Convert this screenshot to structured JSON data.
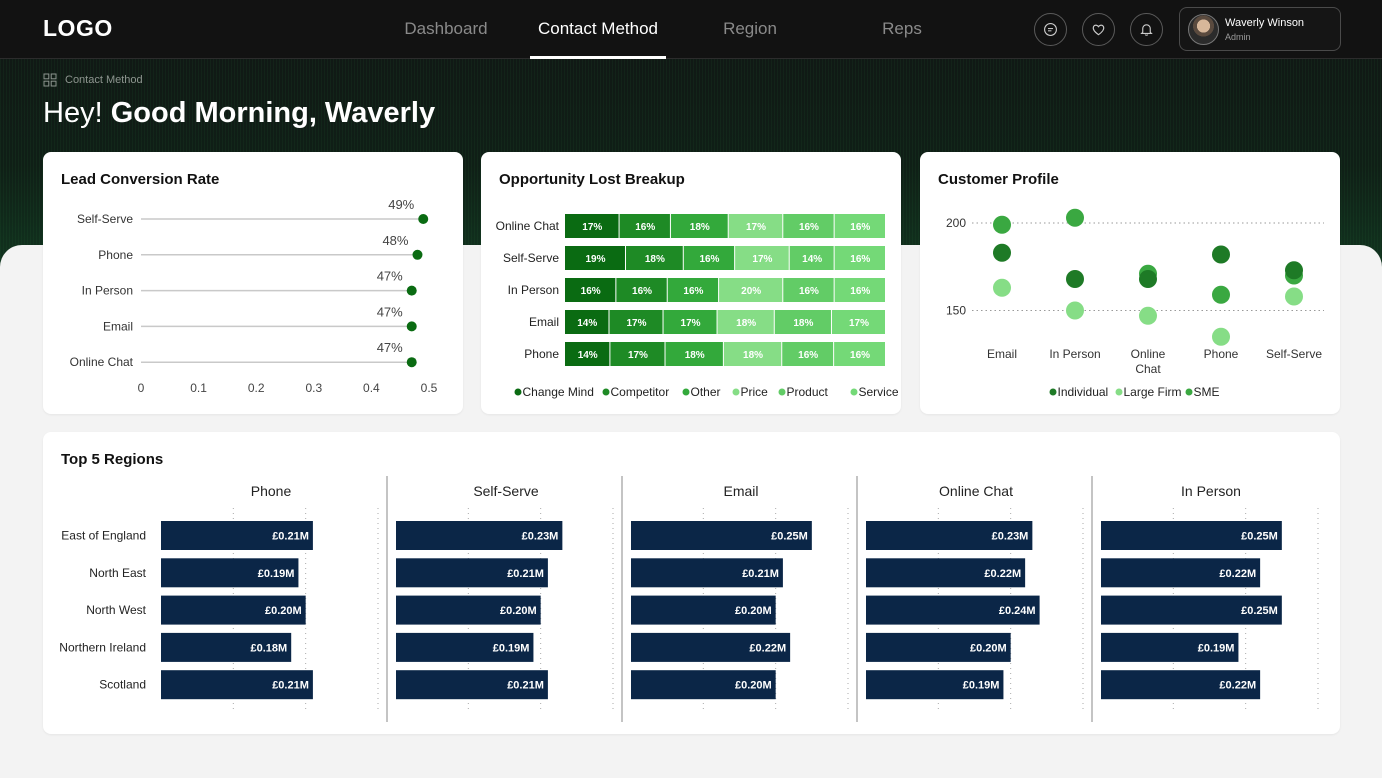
{
  "header": {
    "logo": "LOGO",
    "nav": [
      {
        "label": "Dashboard",
        "active": false
      },
      {
        "label": "Contact Method",
        "active": true
      },
      {
        "label": "Region",
        "active": false
      },
      {
        "label": "Reps",
        "active": false
      }
    ],
    "icons": [
      "chat-icon",
      "heart-icon",
      "bell-icon"
    ],
    "user": {
      "name": "Waverly Winson",
      "role": "Admin"
    }
  },
  "breadcrumb": "Contact Method",
  "greeting": {
    "prefix": "Hey!",
    "main": "Good Morning, Waverly"
  },
  "colors": {
    "dark_green": "#0a6b12",
    "green_1": "#1e8a25",
    "green_2": "#33a93b",
    "light_green": "#86dd86",
    "mid_green": "#62cc66",
    "pale_green": "#74d977",
    "navy": "#0b2647"
  },
  "chart_data": [
    {
      "id": "lead",
      "type": "lollipop",
      "title": "Lead Conversion Rate",
      "categories": [
        "Self-Serve",
        "Phone",
        "In Person",
        "Email",
        "Online Chat"
      ],
      "values": [
        0.49,
        0.48,
        0.47,
        0.47,
        0.47
      ],
      "labels": [
        "49%",
        "48%",
        "47%",
        "47%",
        "47%"
      ],
      "xlim": [
        0,
        0.5
      ],
      "xticks": [
        "0",
        "0.1",
        "0.2",
        "0.3",
        "0.4",
        "0.5"
      ]
    },
    {
      "id": "opportunity",
      "type": "stacked-bar",
      "title": "Opportunity Lost Breakup",
      "categories": [
        "Online Chat",
        "Self-Serve",
        "In Person",
        "Email",
        "Phone"
      ],
      "series": [
        {
          "name": "Change Mind",
          "color": "#0a6b12",
          "values": [
            17,
            19,
            16,
            14,
            14
          ],
          "labels": [
            "17%",
            "19%",
            "16%",
            "14%",
            "14%"
          ]
        },
        {
          "name": "Competitor",
          "color": "#1e8a25",
          "values": [
            16,
            18,
            16,
            17,
            17
          ],
          "labels": [
            "16%",
            "18%",
            "16%",
            "17%",
            "17%"
          ]
        },
        {
          "name": "Other",
          "color": "#33a93b",
          "values": [
            18,
            16,
            16,
            17,
            18
          ],
          "labels": [
            "18%",
            "16%",
            "16%",
            "17%",
            "18%"
          ]
        },
        {
          "name": "Price",
          "color": "#86dd86",
          "values": [
            17,
            17,
            20,
            18,
            18
          ],
          "labels": [
            "17%",
            "17%",
            "20%",
            "18%",
            "18%"
          ]
        },
        {
          "name": "Product",
          "color": "#62cc66",
          "values": [
            16,
            14,
            16,
            18,
            16
          ],
          "labels": [
            "16%",
            "14%",
            "16%",
            "18%",
            "16%"
          ]
        },
        {
          "name": "Service",
          "color": "#74d977",
          "values": [
            16,
            16,
            16,
            17,
            16
          ],
          "labels": [
            "16%",
            "16%",
            "16%",
            "17%",
            "16%"
          ]
        }
      ]
    },
    {
      "id": "profile",
      "type": "scatter",
      "title": "Customer Profile",
      "categories": [
        "Email",
        "In Person",
        "Online Chat",
        "Phone",
        "Self-Serve"
      ],
      "series": [
        {
          "name": "Individual",
          "color": "#1e7a26",
          "values": [
            183,
            168,
            168,
            182,
            173
          ]
        },
        {
          "name": "Large Firm",
          "color": "#86dd86",
          "values": [
            163,
            150,
            147,
            135,
            158
          ]
        },
        {
          "name": "SME",
          "color": "#3aa841",
          "values": [
            199,
            203,
            171,
            159,
            170
          ]
        }
      ],
      "ylim": [
        120,
        212
      ],
      "yticks": [
        150,
        200
      ]
    },
    {
      "id": "regions",
      "type": "bar",
      "title": "Top 5 Regions",
      "categories": [
        "East of England",
        "North East",
        "North West",
        "Northern Ireland",
        "Scotland"
      ],
      "panels": [
        {
          "name": "Phone",
          "values": [
            0.21,
            0.19,
            0.2,
            0.18,
            0.21
          ],
          "labels": [
            "£0.21M",
            "£0.19M",
            "£0.20M",
            "£0.18M",
            "£0.21M"
          ]
        },
        {
          "name": "Self-Serve",
          "values": [
            0.23,
            0.21,
            0.2,
            0.19,
            0.21
          ],
          "labels": [
            "£0.23M",
            "£0.21M",
            "£0.20M",
            "£0.19M",
            "£0.21M"
          ]
        },
        {
          "name": "Email",
          "values": [
            0.25,
            0.21,
            0.2,
            0.22,
            0.2
          ],
          "labels": [
            "£0.25M",
            "£0.21M",
            "£0.20M",
            "£0.22M",
            "£0.20M"
          ]
        },
        {
          "name": "Online Chat",
          "values": [
            0.23,
            0.22,
            0.24,
            0.2,
            0.19
          ],
          "labels": [
            "£0.23M",
            "£0.22M",
            "£0.24M",
            "£0.20M",
            "£0.19M"
          ]
        },
        {
          "name": "In Person",
          "values": [
            0.25,
            0.22,
            0.25,
            0.19,
            0.22
          ],
          "labels": [
            "£0.25M",
            "£0.22M",
            "£0.25M",
            "£0.19M",
            "£0.22M"
          ]
        }
      ],
      "xlim": [
        0,
        0.3
      ]
    }
  ]
}
